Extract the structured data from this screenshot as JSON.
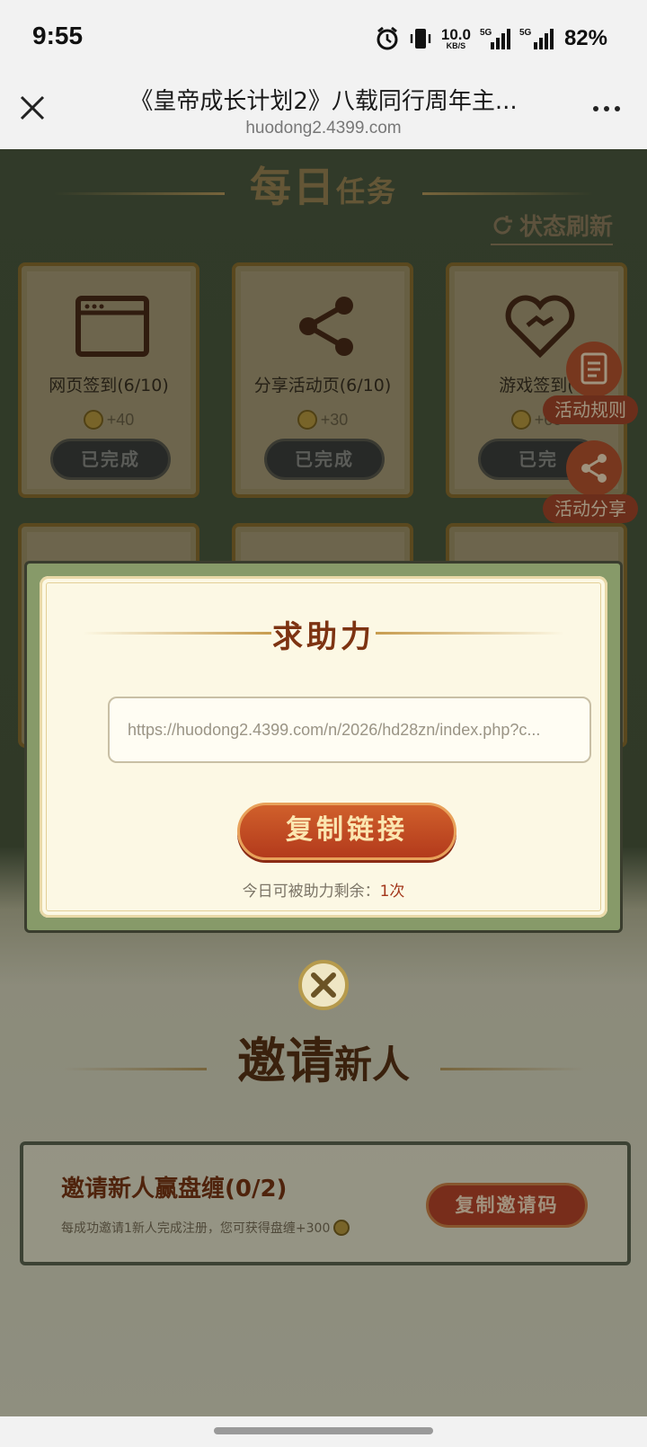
{
  "status_bar": {
    "time": "9:55",
    "net_speed_value": "10.0",
    "net_speed_unit": "KB/S",
    "signal1_label": "5G",
    "signal2_label": "5G",
    "battery": "82%"
  },
  "browser": {
    "title": "《皇帝成长计划2》八载同行周年主...",
    "host": "huodong2.4399.com"
  },
  "daily_tasks": {
    "title_main": "每日",
    "title_sub": "任务",
    "refresh_label": "状态刷新",
    "tasks": [
      {
        "label": "网页签到(6/10)",
        "reward": "+40",
        "status": "已完成",
        "icon": "browser-window-icon"
      },
      {
        "label": "分享活动页(6/10)",
        "reward": "+30",
        "status": "已完成",
        "icon": "share-icon"
      },
      {
        "label": "游戏签到(",
        "reward": "+60",
        "status": "已完",
        "icon": "heart-handshake-icon"
      }
    ]
  },
  "floating": {
    "rules_label": "活动规则",
    "share_label": "活动分享"
  },
  "modal": {
    "title": "求助力",
    "link": "https://huodong2.4399.com/n/2026/hd28zn/index.php?c...",
    "copy_button": "复制链接",
    "remain_label": "今日可被助力剩余：",
    "remain_count": "1次"
  },
  "invite": {
    "title_main": "邀请",
    "title_sub": "新人",
    "task_name": "邀请新人赢盘缠(0/2)",
    "task_desc": "每成功邀请1新人完成注册，您可获得盘缠+300",
    "copy_code_button": "复制邀请码"
  },
  "colors": {
    "modal_title": "#7d3312",
    "button_red": "#b8462a",
    "page_green": "#4c5a3f"
  }
}
